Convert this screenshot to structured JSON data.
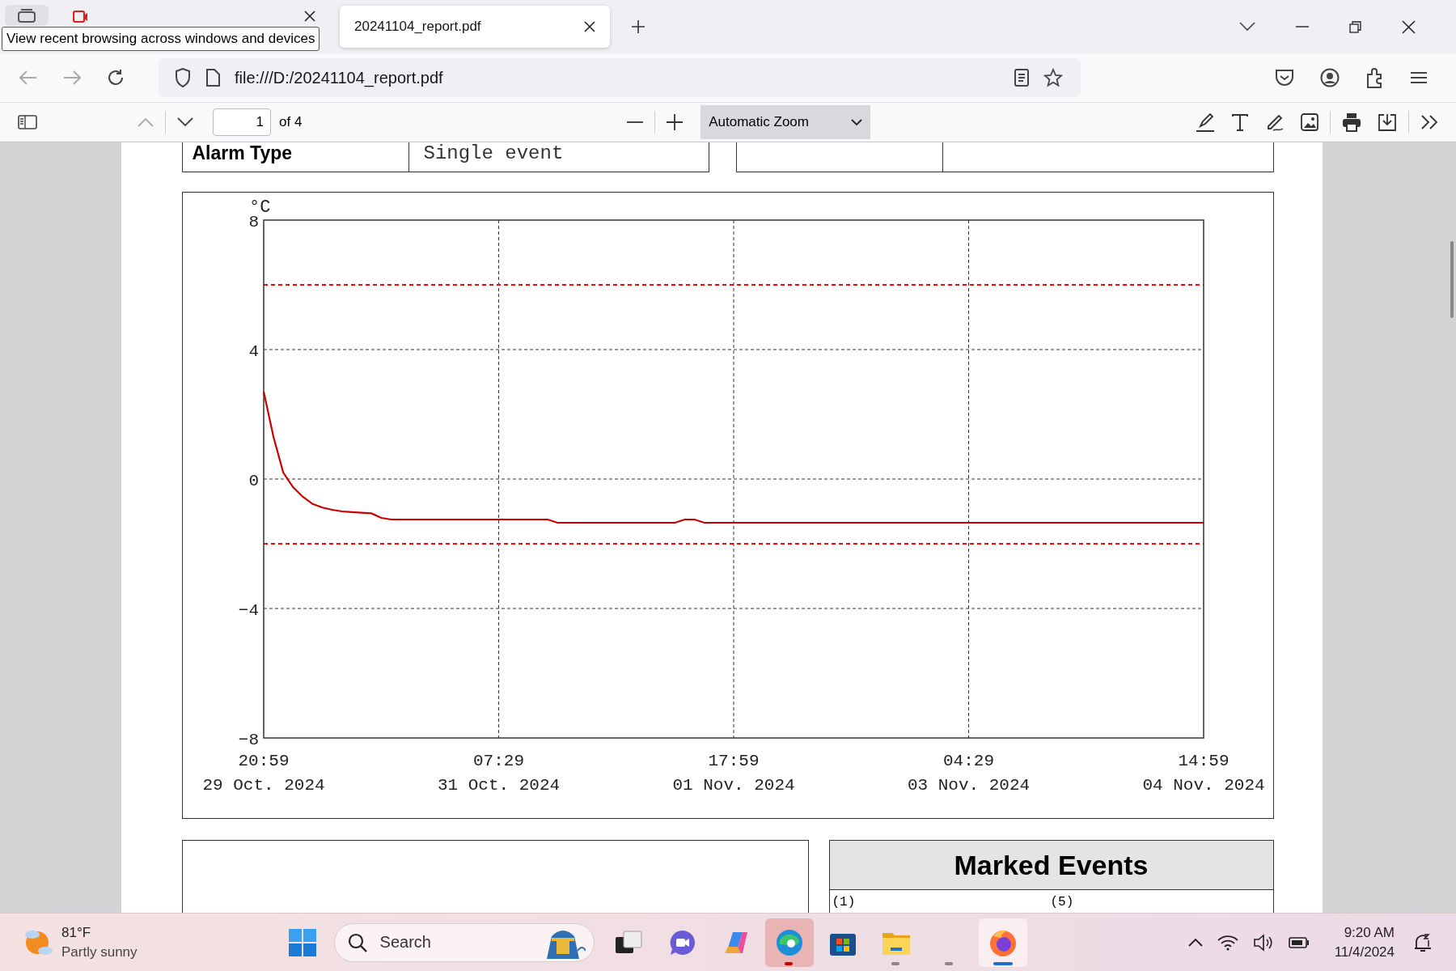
{
  "browser": {
    "tabs": [
      {
        "selected": false
      },
      {
        "label": "20241104_report.pdf",
        "selected": true
      }
    ],
    "tooltip": "View recent browsing across windows and devices",
    "address": "file:///D:/20241104_report.pdf"
  },
  "pdf_toolbar": {
    "page": "1",
    "page_count": "of 4",
    "zoom": "Automatic Zoom"
  },
  "report": {
    "info_rows": [
      {
        "label": "Alarm Type",
        "value": "Single event"
      }
    ],
    "chart": {
      "unit": "°C",
      "chart_data": {
        "type": "line",
        "ylim": [
          -8,
          8
        ],
        "yticks": [
          -8,
          -4,
          0,
          4,
          8
        ],
        "categories": [
          "20:59\n29 Oct. 2024",
          null,
          null,
          null,
          null,
          null,
          null,
          null,
          null,
          null,
          null,
          null,
          null,
          null,
          null,
          null,
          null,
          null,
          null,
          null,
          null,
          null,
          null,
          null,
          "07:29\n31 Oct. 2024",
          null,
          null,
          null,
          null,
          null,
          null,
          null,
          null,
          null,
          null,
          null,
          null,
          null,
          null,
          null,
          null,
          null,
          null,
          null,
          null,
          null,
          null,
          null,
          "17:59\n01 Nov. 2024",
          null,
          null,
          null,
          null,
          null,
          null,
          null,
          null,
          null,
          null,
          null,
          null,
          null,
          null,
          null,
          null,
          null,
          null,
          null,
          null,
          null,
          null,
          null,
          "04:29\n03 Nov. 2024",
          null,
          null,
          null,
          null,
          null,
          null,
          null,
          null,
          null,
          null,
          null,
          null,
          null,
          null,
          null,
          null,
          null,
          null,
          null,
          null,
          null,
          null,
          null,
          "14:59\n04 Nov. 2024"
        ],
        "series": [
          {
            "color": "#cc0000",
            "values": [
              2.7,
              1.3,
              0.2,
              -0.25,
              -0.55,
              -0.77,
              -0.88,
              -0.95,
              -1.0,
              -1.02,
              -1.04,
              -1.06,
              -1.2,
              -1.25,
              -1.25,
              -1.25,
              -1.25,
              -1.25,
              -1.25,
              -1.25,
              -1.25,
              -1.25,
              -1.25,
              -1.25,
              -1.25,
              -1.25,
              -1.25,
              -1.25,
              -1.25,
              -1.25,
              -1.35,
              -1.35,
              -1.35,
              -1.35,
              -1.35,
              -1.35,
              -1.35,
              -1.35,
              -1.35,
              -1.35,
              -1.35,
              -1.35,
              -1.35,
              -1.25,
              -1.25,
              -1.35,
              -1.35,
              -1.35,
              -1.35,
              -1.35,
              -1.35,
              -1.35,
              -1.35,
              -1.35,
              -1.35,
              -1.35,
              -1.35,
              -1.35,
              -1.35,
              -1.35,
              -1.35,
              -1.35,
              -1.35,
              -1.35,
              -1.35,
              -1.35,
              -1.35,
              -1.35,
              -1.35,
              -1.35,
              -1.35,
              -1.35,
              -1.35,
              -1.35,
              -1.35,
              -1.35,
              -1.35,
              -1.35,
              -1.35,
              -1.35,
              -1.35,
              -1.35,
              -1.35,
              -1.35,
              -1.35,
              -1.35,
              -1.35,
              -1.35,
              -1.35,
              -1.35,
              -1.35,
              -1.35,
              -1.35,
              -1.35,
              -1.35,
              -1.35,
              -1.35
            ]
          }
        ],
        "grid": true,
        "ref_lines": [
          {
            "axis": "y",
            "value": 6
          },
          {
            "axis": "y",
            "value": -2
          }
        ]
      }
    },
    "marked_events": {
      "title": "Marked Events",
      "items": [
        "(1)",
        "(5)"
      ]
    }
  },
  "taskbar": {
    "weather": {
      "temp": "81°F",
      "condition": "Partly sunny"
    },
    "search_placeholder": "Search",
    "apps": [
      {
        "kind": "taskview",
        "running": false,
        "attention": false,
        "selected": false
      },
      {
        "kind": "chat",
        "running": false,
        "attention": false,
        "selected": false
      },
      {
        "kind": "copilot",
        "running": false,
        "attention": false,
        "selected": false
      },
      {
        "kind": "edge",
        "running": true,
        "attention": true,
        "selected": false
      },
      {
        "kind": "store",
        "running": false,
        "attention": false,
        "selected": false
      },
      {
        "kind": "explorer",
        "running": true,
        "attention": false,
        "selected": false
      },
      {
        "kind": "blank",
        "running": true,
        "attention": false,
        "selected": false
      },
      {
        "kind": "firefox",
        "running": true,
        "attention": false,
        "selected": true
      }
    ],
    "time": "9:20 AM",
    "date": "11/4/2024"
  }
}
